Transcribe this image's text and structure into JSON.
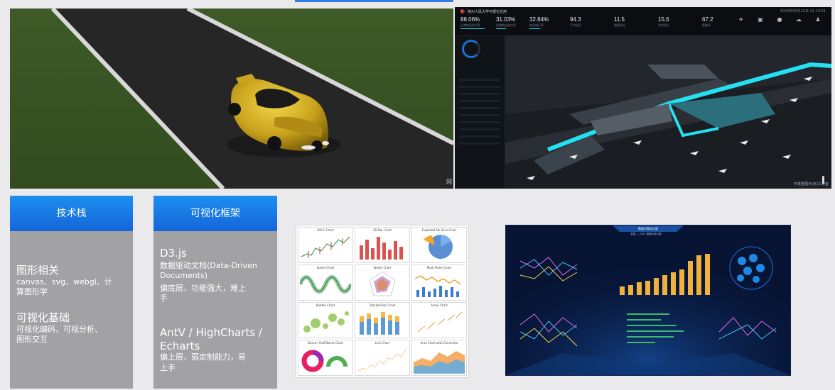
{
  "scene": {
    "watermark": "冈"
  },
  "dashboard": {
    "title": "随州人民大学可视化应用",
    "time": "2020年09月22日 11:13:51",
    "kpis": [
      {
        "value": "88.06%",
        "label": "出港航班准点率"
      },
      {
        "value": "31.03%",
        "label": "进港航班准点率"
      },
      {
        "value": "32.84%",
        "label": "航班放行率"
      },
      {
        "value": "94.3",
        "label": "平均延误"
      },
      {
        "value": "11.5",
        "label": "旅客吞吐"
      },
      {
        "value": "15.6",
        "label": "货邮吞吐"
      },
      {
        "value": "67.2",
        "label": "客座率"
      }
    ],
    "icons": [
      "plane-icon",
      "bus-icon",
      "pin-icon",
      "cloud-icon",
      "user-icon",
      "tool-icon"
    ],
    "watermark": "开发者展示(京)工作室"
  },
  "stack": {
    "title": "技术栈",
    "g1_title": "图形相关",
    "g1_body_a": "canvas、svg、webgl、计",
    "g1_body_b": "算图形学",
    "g2_title": "可视化基础",
    "g2_body_a": "可视化编码、可视分析、",
    "g2_body_b": "图形交互"
  },
  "frameworks": {
    "title": "可视化框架",
    "d3_title": "D3.js",
    "d3_body_a": "数据驱动文档(Data-Driven",
    "d3_body_b": "Documents)",
    "d3_body_c": "偏底层，功能强大，难上",
    "d3_body_d": "手",
    "antv_title_a": "AntV / HighCharts /",
    "antv_title_b": "Echarts",
    "antv_body_a": "偏上层，弱定制能力，易",
    "antv_body_b": "上手"
  },
  "gallery": {
    "charts": [
      "OHLC Chart",
      "3D Bar Chart",
      "Exploded Pie Slice Chart",
      "Spline Chart",
      "Spider Chart",
      "Multi Plane Chart",
      "Bubble Chart",
      "Stacked Bar Chart",
      "Arrow Chart",
      "Donut / Half-Donut Chart",
      "Line Chart",
      "Area Chart with Connector"
    ]
  },
  "bigscreen": {
    "title": "数据可视化大屏",
    "subtitle": "全国  —  2017 数据分析大屏"
  },
  "colors": {
    "banner": "#1565d8",
    "panel": "#a2a2a4",
    "accent": "#23d8f0"
  }
}
